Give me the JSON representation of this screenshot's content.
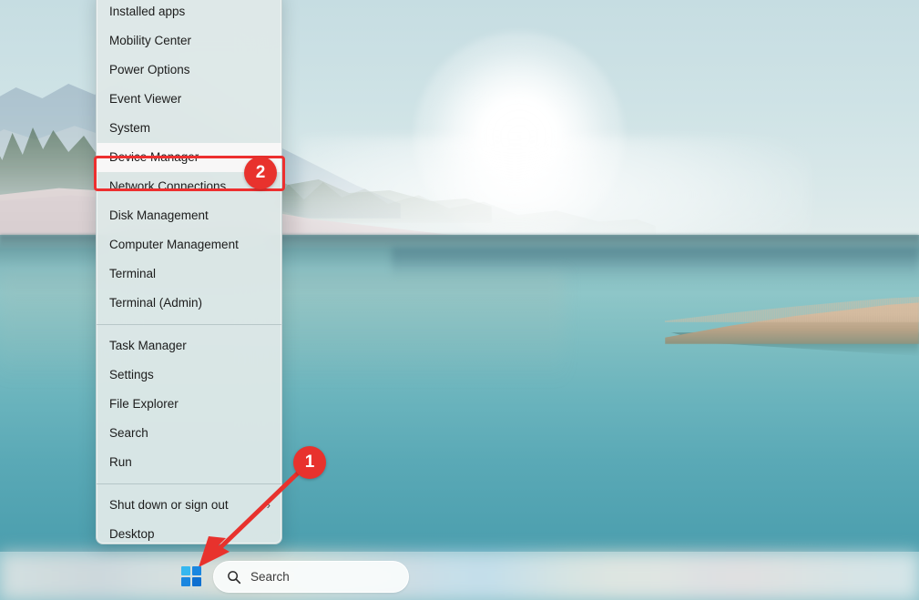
{
  "desktop": {
    "wallpaper_description": "Lake shore with sand dunes, distant mountains, bright sun and a reed spit",
    "colors": {
      "sky": "#cfe3e6",
      "water": "#6bb4bd",
      "sand": "#d9cfd1",
      "reed": "#d8bfa4",
      "accent_red": "#e8322d",
      "menu_background": "#dfe9e8",
      "taskbar": "#eaf2f3"
    }
  },
  "winx_menu": {
    "groups": [
      {
        "items": [
          {
            "label": "Installed apps",
            "submenu": false,
            "highlighted": false
          },
          {
            "label": "Mobility Center",
            "submenu": false,
            "highlighted": false
          },
          {
            "label": "Power Options",
            "submenu": false,
            "highlighted": false
          },
          {
            "label": "Event Viewer",
            "submenu": false,
            "highlighted": false
          },
          {
            "label": "System",
            "submenu": false,
            "highlighted": false
          },
          {
            "label": "Device Manager",
            "submenu": false,
            "highlighted": true
          },
          {
            "label": "Network Connections",
            "submenu": false,
            "highlighted": false
          },
          {
            "label": "Disk Management",
            "submenu": false,
            "highlighted": false
          },
          {
            "label": "Computer Management",
            "submenu": false,
            "highlighted": false
          },
          {
            "label": "Terminal",
            "submenu": false,
            "highlighted": false
          },
          {
            "label": "Terminal (Admin)",
            "submenu": false,
            "highlighted": false
          }
        ]
      },
      {
        "items": [
          {
            "label": "Task Manager",
            "submenu": false,
            "highlighted": false
          },
          {
            "label": "Settings",
            "submenu": false,
            "highlighted": false
          },
          {
            "label": "File Explorer",
            "submenu": false,
            "highlighted": false
          },
          {
            "label": "Search",
            "submenu": false,
            "highlighted": false
          },
          {
            "label": "Run",
            "submenu": false,
            "highlighted": false
          }
        ]
      },
      {
        "items": [
          {
            "label": "Shut down or sign out",
            "submenu": true,
            "submenu_glyph": "›",
            "highlighted": false
          },
          {
            "label": "Desktop",
            "submenu": false,
            "highlighted": false
          }
        ]
      }
    ]
  },
  "annotations": {
    "step_one": {
      "number": "1",
      "target": "start-button"
    },
    "step_two": {
      "number": "2",
      "target": "device-manager-menu-item"
    }
  },
  "taskbar": {
    "start_button": {
      "icon": "windows-logo-icon",
      "label": "Start"
    },
    "search": {
      "icon": "search-icon",
      "placeholder": "Search",
      "value": ""
    }
  }
}
